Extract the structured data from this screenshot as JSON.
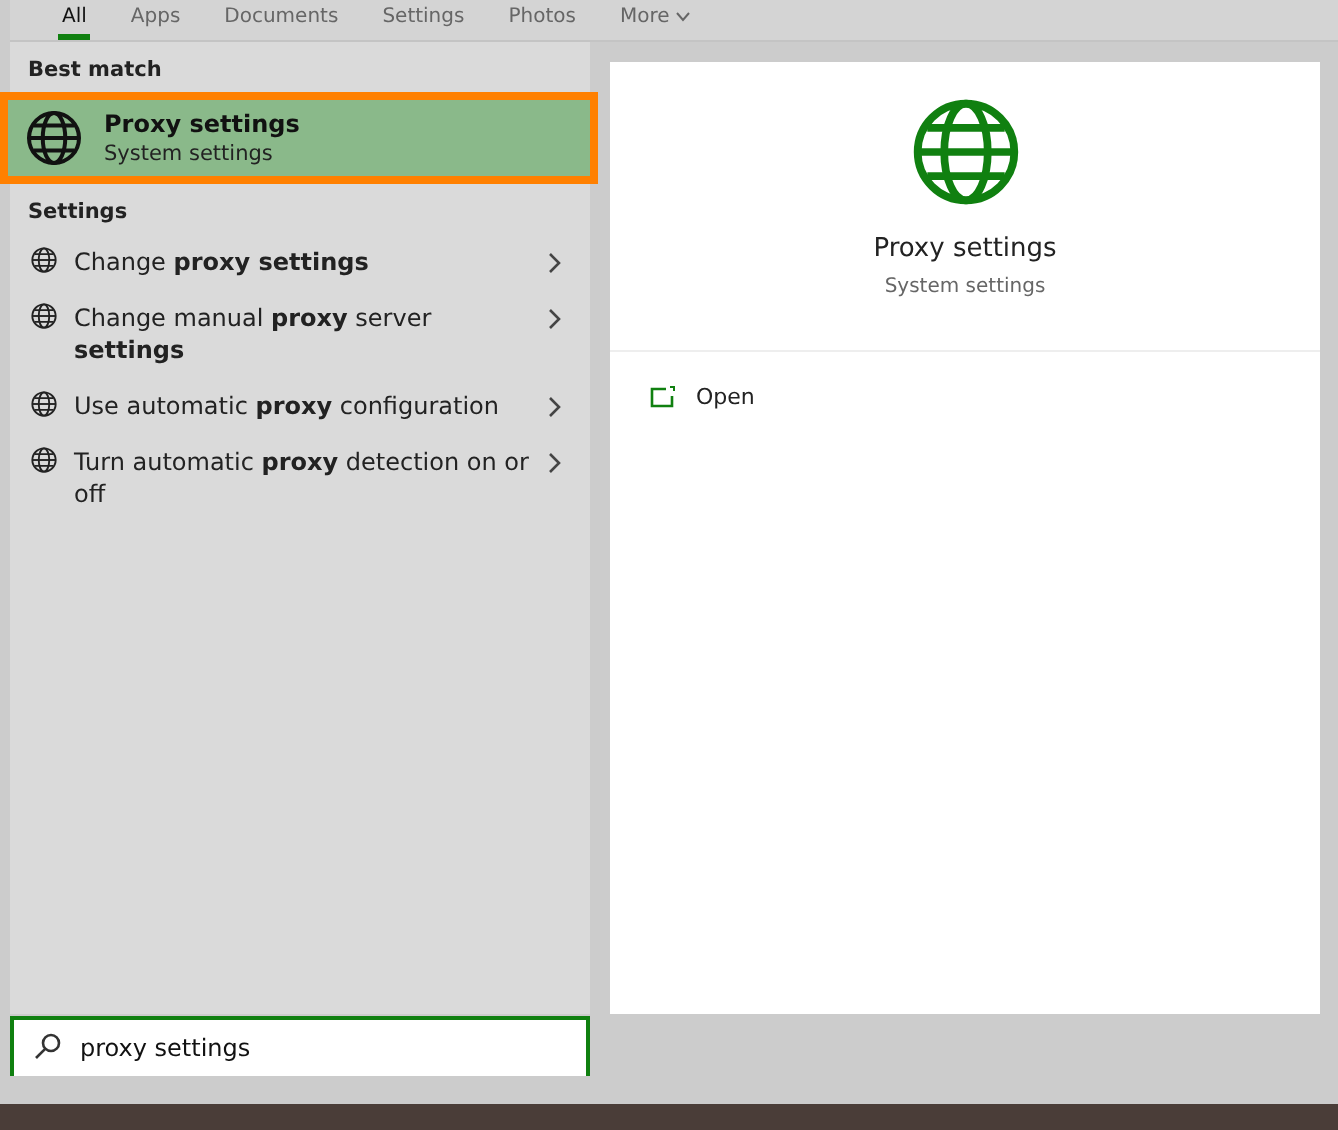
{
  "tabs": [
    {
      "label": "All",
      "selected": true
    },
    {
      "label": "Apps",
      "selected": false
    },
    {
      "label": "Documents",
      "selected": false
    },
    {
      "label": "Settings",
      "selected": false
    },
    {
      "label": "Photos",
      "selected": false
    },
    {
      "label": "More",
      "selected": false,
      "kind": "dropdown"
    }
  ],
  "best_match": {
    "heading": "Best match",
    "title": "Proxy settings",
    "subtitle": "System settings",
    "selected": true
  },
  "settings": {
    "heading": "Settings",
    "items": [
      {
        "label": "Change **proxy settings**"
      },
      {
        "label": "Change manual **proxy** server **settings**"
      },
      {
        "label": "Use automatic **proxy** configuration"
      },
      {
        "label": "Turn automatic **proxy** detection on or off"
      }
    ]
  },
  "preview": {
    "title": "Proxy settings",
    "subtitle": "System settings",
    "actions": [
      {
        "label": "Open"
      }
    ]
  },
  "search": {
    "value": "proxy settings"
  }
}
